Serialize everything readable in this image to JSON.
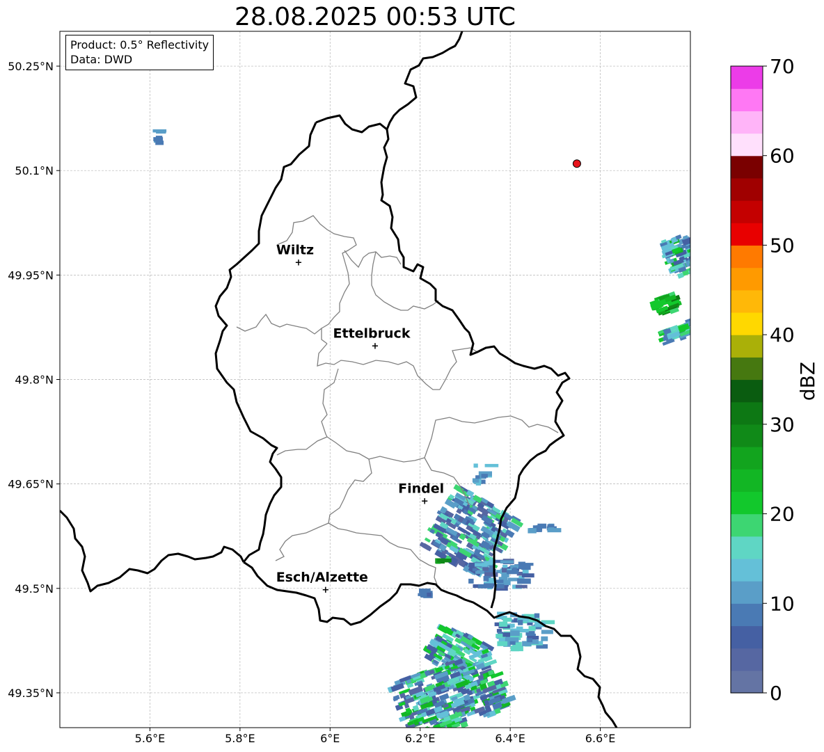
{
  "title": "28.08.2025 00:53 UTC",
  "info_box": {
    "product": "Product: 0.5° Reflectivity",
    "data": "Data: DWD"
  },
  "axes": {
    "lon_ticks": [
      "5.6°E",
      "5.8°E",
      "6°E",
      "6.2°E",
      "6.4°E",
      "6.6°E"
    ],
    "lat_ticks": [
      "50.25°N",
      "50.1°N",
      "49.95°N",
      "49.8°N",
      "49.65°N",
      "49.5°N",
      "49.35°N"
    ],
    "lon_range": [
      5.4,
      6.8
    ],
    "lat_range": [
      49.3,
      50.3
    ]
  },
  "cities": [
    {
      "name": "Wiltz",
      "lon": 5.93,
      "lat": 49.97
    },
    {
      "name": "Ettelbruck",
      "lon": 6.1,
      "lat": 49.85
    },
    {
      "name": "Findel",
      "lon": 6.21,
      "lat": 49.627
    },
    {
      "name": "Esch/Alzette",
      "lon": 5.99,
      "lat": 49.5
    }
  ],
  "radar_site": {
    "lon": 6.548,
    "lat": 50.11,
    "color": "#e8141c"
  },
  "colorbar": {
    "label": "dBZ",
    "ticks": [
      "0",
      "10",
      "20",
      "30",
      "40",
      "50",
      "60",
      "70"
    ],
    "colors": [
      "#6474a4",
      "#5667a2",
      "#4560a3",
      "#4a7ab4",
      "#5a9ec8",
      "#64c0d8",
      "#5fd6c4",
      "#3dd672",
      "#12c82c",
      "#12b624",
      "#12a41e",
      "#108a18",
      "#0d7814",
      "#0a5c10",
      "#467810",
      "#aab008",
      "#ffd800",
      "#ffb808",
      "#ff9a00",
      "#ff7a00",
      "#e80000",
      "#c40000",
      "#a00000",
      "#7a0000",
      "#ffe0fc",
      "#ffb4f8",
      "#ff78f4",
      "#ec3ce8"
    ]
  }
}
